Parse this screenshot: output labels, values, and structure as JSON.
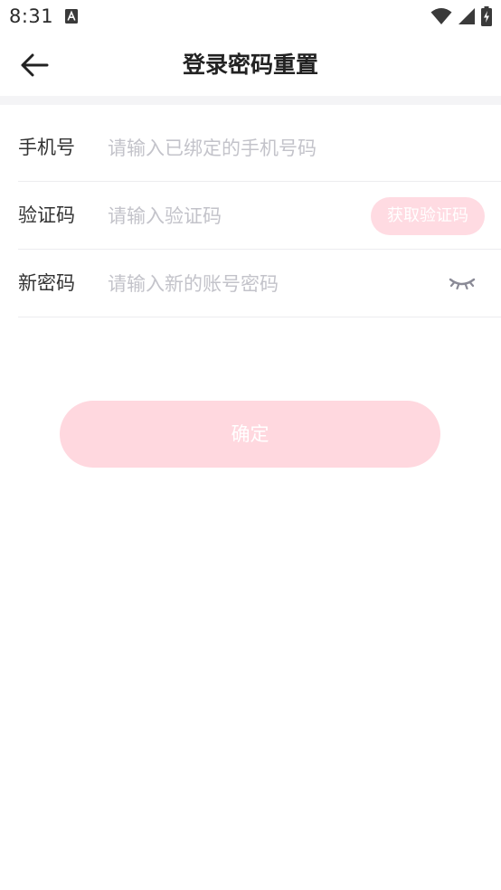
{
  "status_bar": {
    "time": "8:31",
    "icons": [
      "a-notification-icon",
      "wifi-icon",
      "cellular-signal-icon",
      "battery-charging-icon"
    ]
  },
  "nav": {
    "title": "登录密码重置",
    "back_icon": "arrow-left-icon"
  },
  "form": {
    "phone": {
      "label": "手机号",
      "placeholder": "请输入已绑定的手机号码",
      "value": ""
    },
    "code": {
      "label": "验证码",
      "placeholder": "请输入验证码",
      "value": "",
      "get_code_label": "获取验证码"
    },
    "password": {
      "label": "新密码",
      "placeholder": "请输入新的账号密码",
      "value": "",
      "toggle_icon": "eye-closed-icon"
    }
  },
  "confirm_label": "确定",
  "colors": {
    "accent_soft": "#ffd8df",
    "placeholder": "#c3c3ca",
    "label": "#333333",
    "title": "#222222"
  }
}
